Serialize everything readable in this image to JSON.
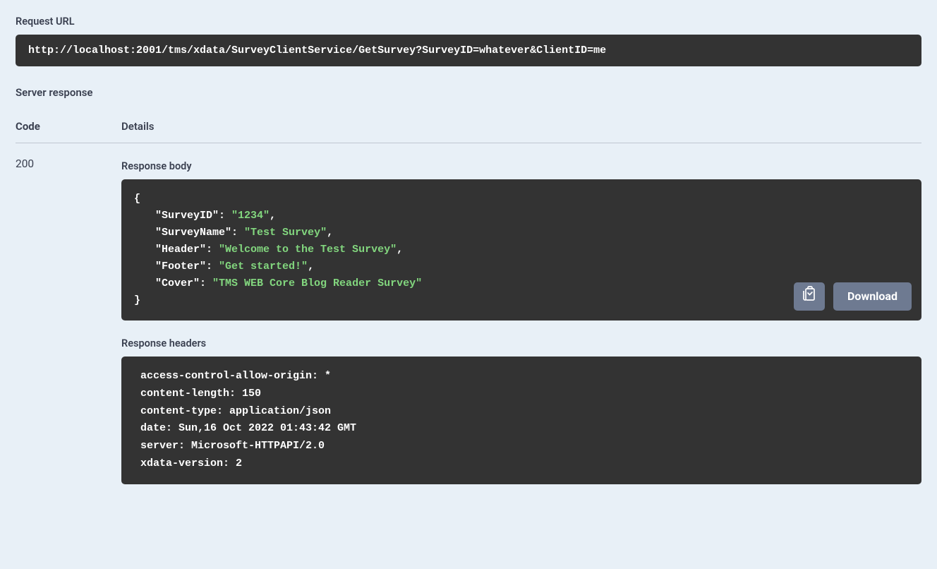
{
  "request": {
    "url_label": "Request URL",
    "url": "http://localhost:2001/tms/xdata/SurveyClientService/GetSurvey?SurveyID=whatever&ClientID=me"
  },
  "response": {
    "label": "Server response",
    "columns": {
      "code": "Code",
      "details": "Details"
    },
    "code": "200",
    "body_label": "Response body",
    "body_fields": [
      {
        "key": "SurveyID",
        "value": "1234"
      },
      {
        "key": "SurveyName",
        "value": "Test Survey"
      },
      {
        "key": "Header",
        "value": "Welcome to the Test Survey"
      },
      {
        "key": "Footer",
        "value": "Get started!"
      },
      {
        "key": "Cover",
        "value": "TMS WEB Core Blog Reader Survey"
      }
    ],
    "headers_label": "Response headers",
    "headers": [
      {
        "name": "access-control-allow-origin",
        "value": "*"
      },
      {
        "name": "content-length",
        "value": "150"
      },
      {
        "name": "content-type",
        "value": "application/json"
      },
      {
        "name": "date",
        "value": "Sun,16 Oct 2022 01:43:42 GMT"
      },
      {
        "name": "server",
        "value": "Microsoft-HTTPAPI/2.0"
      },
      {
        "name": "xdata-version",
        "value": "2"
      }
    ],
    "buttons": {
      "download_label": "Download"
    }
  }
}
